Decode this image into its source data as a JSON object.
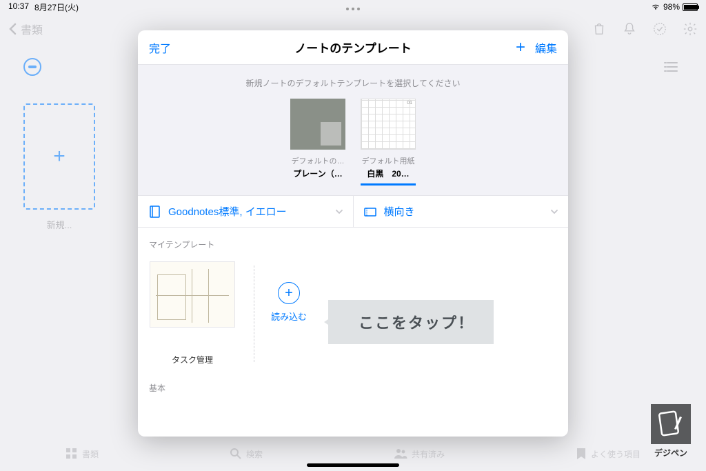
{
  "status": {
    "time": "10:37",
    "date": "8月27日(火)",
    "battery": "98%"
  },
  "nav": {
    "back": "書類"
  },
  "bg": {
    "new_label": "新規..."
  },
  "modal": {
    "done": "完了",
    "title": "ノートのテンプレート",
    "edit": "編集",
    "hint": "新規ノートのデフォルトテンプレートを選択してください",
    "default_templates": [
      {
        "label1": "デフォルトの…",
        "label2": "プレーン（…"
      },
      {
        "label1": "デフォルト用紙",
        "label2": "白黒　20…"
      }
    ],
    "selector_cover": "Goodnotes標準, イエロー",
    "selector_orientation": "横向き",
    "section_my": "マイテンプレート",
    "templates": [
      {
        "name": "タスク管理"
      }
    ],
    "import": "読み込む",
    "section_basic": "基本"
  },
  "callout": "ここをタップ！",
  "tabs": {
    "docs": "書類",
    "search": "検索",
    "shared": "共有済み",
    "favorites": "よく使う項目"
  },
  "watermark": "デジペン"
}
